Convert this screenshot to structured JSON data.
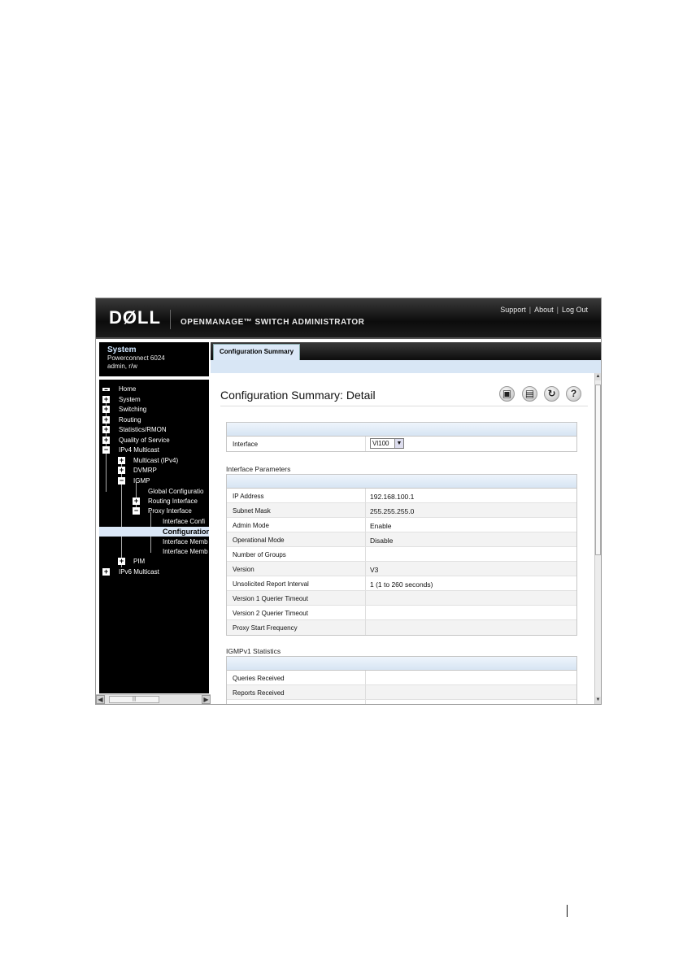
{
  "header": {
    "logo": "DØLL",
    "product_title": "OPENMANAGE™ SWITCH ADMINISTRATOR",
    "links": [
      "Support",
      "About",
      "Log Out"
    ]
  },
  "system_panel": {
    "title": "System",
    "model": "Powerconnect 6024",
    "user": "admin, r/w"
  },
  "nav": {
    "items": [
      {
        "label": "Home"
      },
      {
        "label": "System"
      },
      {
        "label": "Switching"
      },
      {
        "label": "Routing"
      },
      {
        "label": "Statistics/RMON"
      },
      {
        "label": "Quality of Service"
      },
      {
        "label": "IPv4 Multicast"
      },
      {
        "label": "Multicast (IPv4)"
      },
      {
        "label": "DVMRP"
      },
      {
        "label": "IGMP"
      },
      {
        "label": "Global Configuratio"
      },
      {
        "label": "Routing Interface"
      },
      {
        "label": "Proxy Interface"
      },
      {
        "label": "Interface Confi"
      },
      {
        "label": "Configuration"
      },
      {
        "label": "Interface Memb"
      },
      {
        "label": "Interface Memb"
      },
      {
        "label": "PIM"
      },
      {
        "label": "IPv6 Multicast"
      }
    ]
  },
  "tabs": [
    "Configuration Summary"
  ],
  "page": {
    "title": "Configuration Summary: Detail",
    "toolbar_icons": [
      "save-icon",
      "print-icon",
      "refresh-icon",
      "help-icon"
    ]
  },
  "interface_table": {
    "label": "Interface",
    "selected": "Vl100"
  },
  "interface_parameters": {
    "title": "Interface Parameters",
    "rows": [
      {
        "label": "IP Address",
        "value": "192.168.100.1"
      },
      {
        "label": "Subnet Mask",
        "value": "255.255.255.0"
      },
      {
        "label": "Admin Mode",
        "value": "Enable"
      },
      {
        "label": "Operational Mode",
        "value": "Disable"
      },
      {
        "label": "Number of Groups",
        "value": ""
      },
      {
        "label": "Version",
        "value": "V3"
      },
      {
        "label": "Unsolicited Report Interval",
        "value": "1  (1 to 260 seconds)"
      },
      {
        "label": "Version 1 Querier Timeout",
        "value": ""
      },
      {
        "label": "Version 2 Querier Timeout",
        "value": ""
      },
      {
        "label": "Proxy Start Frequency",
        "value": ""
      }
    ]
  },
  "igmpv1_statistics": {
    "title": "IGMPv1 Statistics",
    "rows": [
      {
        "label": "Queries Received",
        "value": ""
      },
      {
        "label": "Reports Received",
        "value": ""
      },
      {
        "label": "",
        "value": ""
      }
    ]
  }
}
